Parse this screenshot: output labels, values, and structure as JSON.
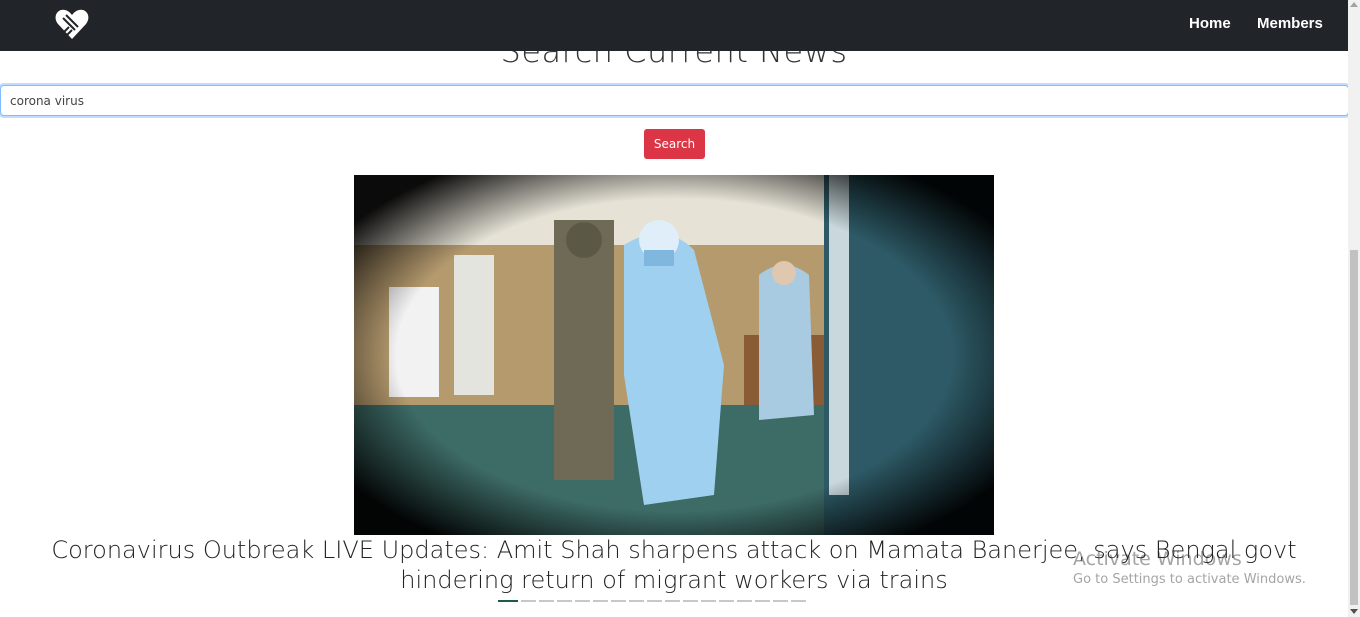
{
  "nav": {
    "logo_icon": "heart-hands-icon",
    "links": [
      {
        "label": "Home"
      },
      {
        "label": "Members"
      }
    ]
  },
  "page": {
    "title": "Search Current News"
  },
  "search": {
    "value": "corona virus",
    "button_label": "Search"
  },
  "carousel": {
    "image_alt": "photo of medical workers in blue protective suits in a hospital corridor",
    "headline": "Coronavirus Outbreak LIVE Updates: Amit Shah sharpens attack on Mamata Banerjee, says Bengal govt hindering return of migrant workers via trains",
    "indicator_count": 17,
    "active_index": 0
  },
  "watermark": {
    "title": "Activate Windows",
    "subtitle": "Go to Settings to activate Windows."
  },
  "colors": {
    "navbar": "#212529",
    "search_button": "#dc3545",
    "active_indicator": "#1e5b4c"
  }
}
